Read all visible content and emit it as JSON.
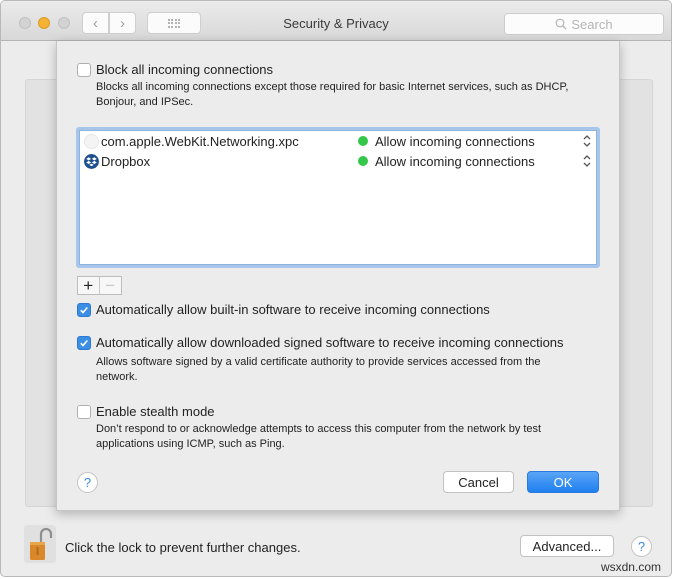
{
  "window": {
    "title": "Security & Privacy",
    "search_placeholder": "Search"
  },
  "firewall_options": {
    "block_all": {
      "label": "Block all incoming connections",
      "checked": false,
      "description": "Blocks all incoming connections except those required for basic Internet services, such as DHCP, Bonjour, and IPSec."
    },
    "apps": [
      {
        "name": "com.apple.WebKit.Networking.xpc",
        "icon": "blank-app-icon",
        "status": "Allow incoming connections",
        "status_color": "#34c749"
      },
      {
        "name": "Dropbox",
        "icon": "dropbox-icon",
        "status": "Allow incoming connections",
        "status_color": "#34c749"
      }
    ],
    "add_label": "+",
    "remove_label": "−",
    "auto_builtin": {
      "label": "Automatically allow built-in software to receive incoming connections",
      "checked": true
    },
    "auto_signed": {
      "label": "Automatically allow downloaded signed software to receive incoming connections",
      "checked": true,
      "description": "Allows software signed by a valid certificate authority to provide services accessed from the network."
    },
    "stealth": {
      "label": "Enable stealth mode",
      "checked": false,
      "description": "Don’t respond to or acknowledge attempts to access this computer from the network by test applications using ICMP, such as Ping."
    },
    "help_label": "?",
    "cancel_label": "Cancel",
    "ok_label": "OK"
  },
  "bottom": {
    "lock_text": "Click the lock to prevent further changes.",
    "advanced_label": "Advanced...",
    "help_label": "?"
  },
  "watermark": "wsxdn.com",
  "colors": {
    "accent": "#3a8ee6",
    "ok_button": "#1f7ff0",
    "allow_dot": "#34c749"
  }
}
